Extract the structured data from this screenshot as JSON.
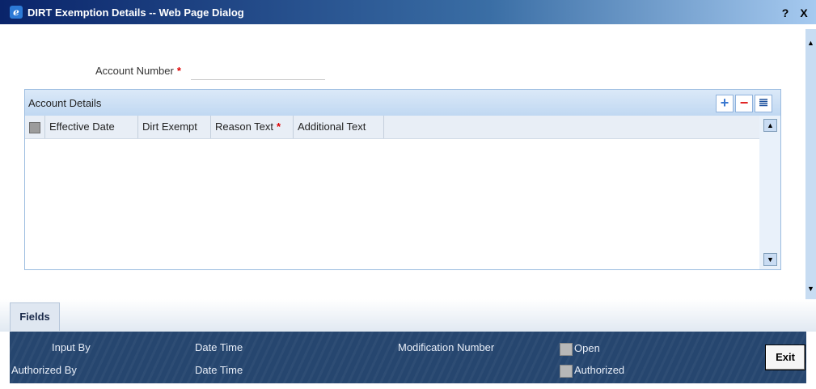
{
  "window": {
    "title": "DIRT Exemption Details -- Web Page Dialog",
    "help_label": "?",
    "close_label": "X"
  },
  "form": {
    "account_number_label": "Account Number",
    "required_mark": "*",
    "account_number_value": ""
  },
  "grid": {
    "title": "Account Details",
    "add_label": "+",
    "delete_label": "−",
    "view_label": "≣",
    "columns": [
      "Effective Date",
      "Dirt Exempt",
      "Reason Text",
      "Additional Text"
    ],
    "required_mark": "*",
    "scroll_up": "▲",
    "scroll_down": "▼"
  },
  "tabs": {
    "fields": "Fields"
  },
  "footer": {
    "input_by": "Input By",
    "date_time_1": "Date Time",
    "modification_number": "Modification Number",
    "open": "Open",
    "authorized_by": "Authorized By",
    "date_time_2": "Date Time",
    "authorized": "Authorized",
    "exit": "Exit"
  },
  "scrollbar": {
    "up": "▲",
    "down": "▼"
  },
  "colors": {
    "title_bar": "#0a246a",
    "grid_header": "#c0d8f2",
    "footer_bg": "#26466f",
    "required": "#e00000",
    "add_icon": "#3a78d0",
    "delete_icon": "#e02020"
  }
}
